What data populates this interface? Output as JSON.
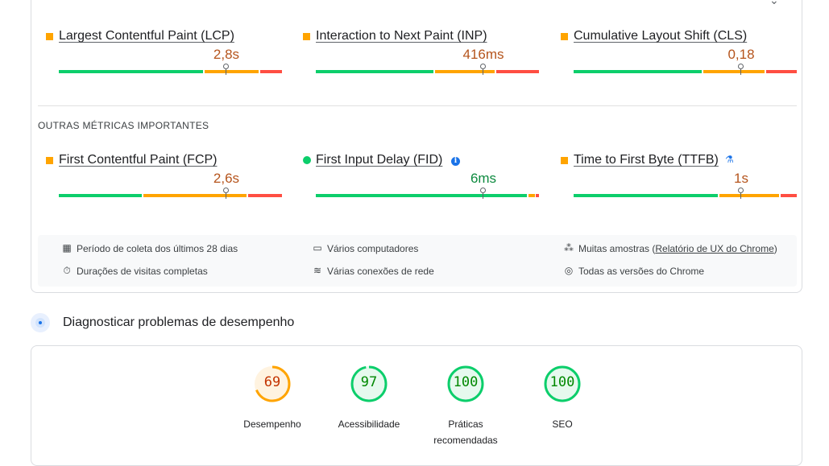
{
  "core_metrics": [
    {
      "label": "Largest Contentful Paint (LCP)",
      "value": "2,8s",
      "status": "average",
      "indicator": "square"
    },
    {
      "label": "Interaction to Next Paint (INP)",
      "value": "416ms",
      "status": "average",
      "indicator": "square"
    },
    {
      "label": "Cumulative Layout Shift (CLS)",
      "value": "0,18",
      "status": "average",
      "indicator": "square"
    }
  ],
  "other_metrics_title": "OUTRAS MÉTRICAS IMPORTANTES",
  "other_metrics": [
    {
      "label": "First Contentful Paint (FCP)",
      "value": "2,6s",
      "status": "average",
      "indicator": "square",
      "icon": "square-icon"
    },
    {
      "label": "First Input Delay (FID)",
      "value": "6ms",
      "status": "good",
      "indicator": "circle",
      "icon": "info-icon"
    },
    {
      "label": "Time to First Byte (TTFB)",
      "value": "1s",
      "status": "average",
      "indicator": "square",
      "icon": "flask-icon"
    }
  ],
  "info": {
    "period": "Período de coleta dos últimos 28 dias",
    "durations": "Durações de visitas completas",
    "devices": "Vários computadores",
    "network": "Várias conexões de rede",
    "samples_prefix": "Muitas amostras (",
    "samples_link": "Relatório de UX do Chrome",
    "samples_suffix": ")",
    "chrome": "Todas as versões do Chrome"
  },
  "diagnose_title": "Diagnosticar problemas de desempenho",
  "scores": [
    {
      "value": "69",
      "label_line1": "Desempenho",
      "label_line2": "",
      "status": "average"
    },
    {
      "value": "97",
      "label_line1": "Acessibilidade",
      "label_line2": "",
      "status": "good"
    },
    {
      "value": "100",
      "label_line1": "Práticas",
      "label_line2": "recomendadas",
      "status": "good"
    },
    {
      "value": "100",
      "label_line1": "SEO",
      "label_line2": "",
      "status": "good"
    }
  ],
  "colors": {
    "good": "#0cce6b",
    "average": "#ffa400",
    "poor": "#ff4e42",
    "link": "#1a73e8"
  }
}
